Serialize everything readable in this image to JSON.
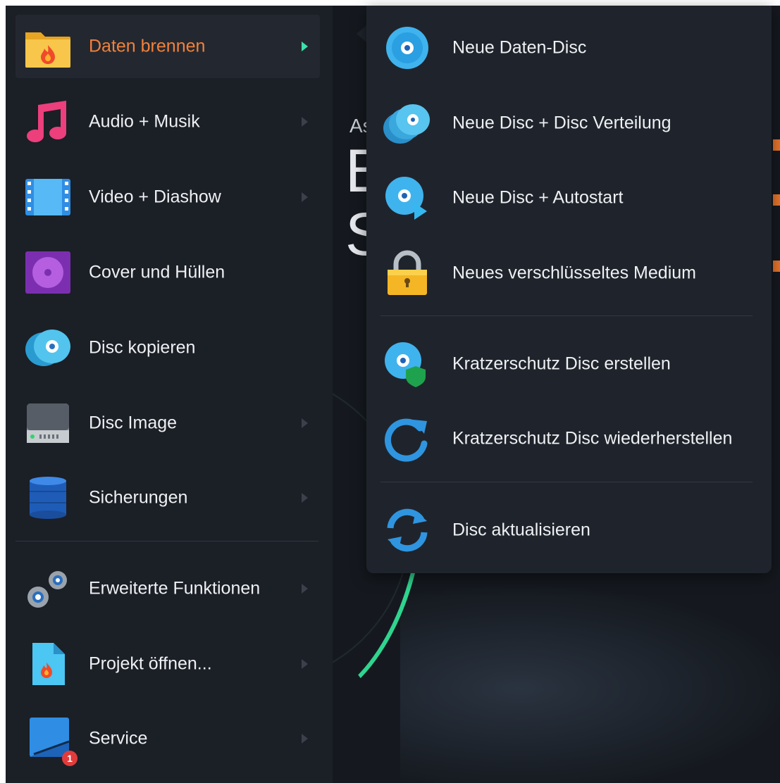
{
  "background": {
    "title_small": "As",
    "title_big": "B\nS"
  },
  "main_menu": {
    "items": [
      {
        "label": "Daten brennen",
        "icon": "folder-flame-icon",
        "active": true
      },
      {
        "label": "Audio + Musik",
        "icon": "music-note-icon"
      },
      {
        "label": "Video + Diashow",
        "icon": "film-strip-icon"
      },
      {
        "label": "Cover und Hüllen",
        "icon": "disc-cover-icon"
      },
      {
        "label": "Disc kopieren",
        "icon": "disc-copy-icon"
      },
      {
        "label": "Disc Image",
        "icon": "hard-drive-icon"
      },
      {
        "label": "Sicherungen",
        "icon": "database-icon"
      },
      {
        "label": "Erweiterte Funktionen",
        "icon": "gears-icon"
      },
      {
        "label": "Projekt öffnen...",
        "icon": "project-file-icon"
      },
      {
        "label": "Service",
        "icon": "service-icon",
        "badge": "1"
      }
    ]
  },
  "sub_menu": {
    "items": [
      {
        "label": "Neue Daten-Disc",
        "icon": "disc-icon"
      },
      {
        "label": "Neue Disc + Disc Verteilung",
        "icon": "disc-stack-icon"
      },
      {
        "label": "Neue Disc + Autostart",
        "icon": "disc-play-icon"
      },
      {
        "label": "Neues verschlüsseltes Medium",
        "icon": "padlock-icon"
      },
      {
        "label": "Kratzerschutz Disc erstellen",
        "icon": "disc-shield-icon"
      },
      {
        "label": "Kratzerschutz Disc wiederherstellen",
        "icon": "restore-arrow-icon"
      },
      {
        "label": "Disc aktualisieren",
        "icon": "refresh-icon"
      }
    ]
  },
  "colors": {
    "accent_active": "#f2813a",
    "arrow_active": "#3ee0a9",
    "menu_bg": "#1b1f26",
    "submenu_bg": "#1f242c"
  }
}
